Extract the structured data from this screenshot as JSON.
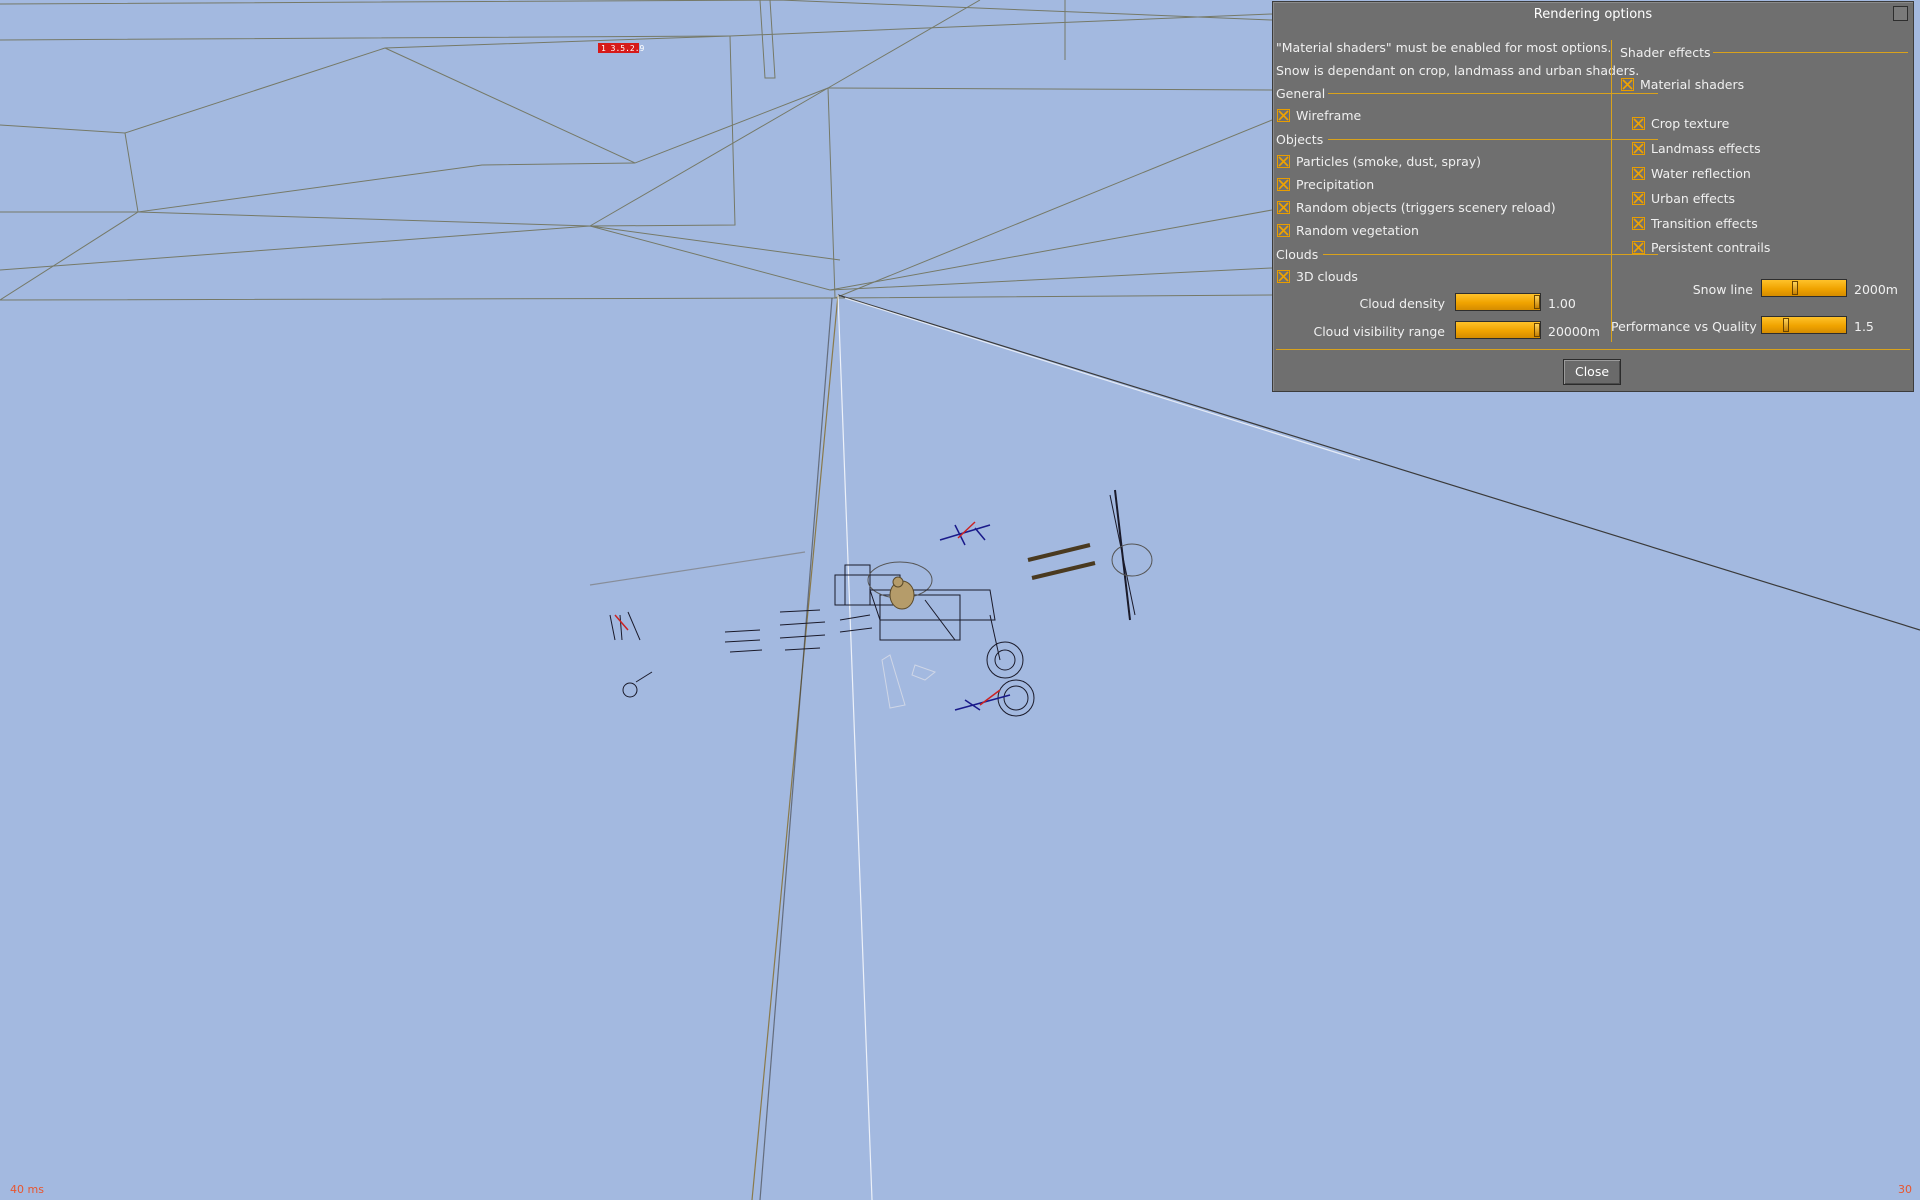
{
  "hud": {
    "frame_time": "40 ms",
    "fps": "30",
    "tag_text": "1 3.5.2.9"
  },
  "dialog": {
    "title": "Rendering options",
    "notes": [
      "\"Material shaders\" must be enabled for most options.",
      "Snow is dependant on crop, landmass and urban shaders."
    ],
    "sections": {
      "general": "General",
      "objects": "Objects",
      "clouds": "Clouds",
      "shader_effects": "Shader effects"
    },
    "options": {
      "wireframe": {
        "label": "Wireframe",
        "checked": true
      },
      "particles": {
        "label": "Particles (smoke, dust, spray)",
        "checked": true
      },
      "precipitation": {
        "label": "Precipitation",
        "checked": true
      },
      "random_objects": {
        "label": "Random objects (triggers scenery reload)",
        "checked": true
      },
      "random_vegetation": {
        "label": "Random vegetation",
        "checked": true
      },
      "clouds_3d": {
        "label": "3D clouds",
        "checked": true
      },
      "material_shaders": {
        "label": "Material shaders",
        "checked": true
      },
      "crop_texture": {
        "label": "Crop texture",
        "checked": true
      },
      "landmass_effects": {
        "label": "Landmass effects",
        "checked": true
      },
      "water_reflection": {
        "label": "Water reflection",
        "checked": true
      },
      "urban_effects": {
        "label": "Urban effects",
        "checked": true
      },
      "transition_effects": {
        "label": "Transition effects",
        "checked": true
      },
      "persistent_contrails": {
        "label": "Persistent contrails",
        "checked": true
      }
    },
    "sliders": {
      "cloud_density": {
        "label": "Cloud density",
        "value": "1.00",
        "fraction": 1.0
      },
      "cloud_visibility": {
        "label": "Cloud visibility range",
        "value": "20000m",
        "fraction": 1.0
      },
      "snow_line": {
        "label": "Snow line",
        "value": "2000m",
        "fraction": 0.38
      },
      "performance_quality": {
        "label": "Performance vs Quality",
        "value": "1.5",
        "fraction": 0.27
      }
    },
    "close_label": "Close"
  },
  "colors": {
    "sky": "#a3b9e0",
    "dialog_bg": "#6f6f6f",
    "accent": "#f0a300",
    "hud_text": "#e8552e"
  }
}
